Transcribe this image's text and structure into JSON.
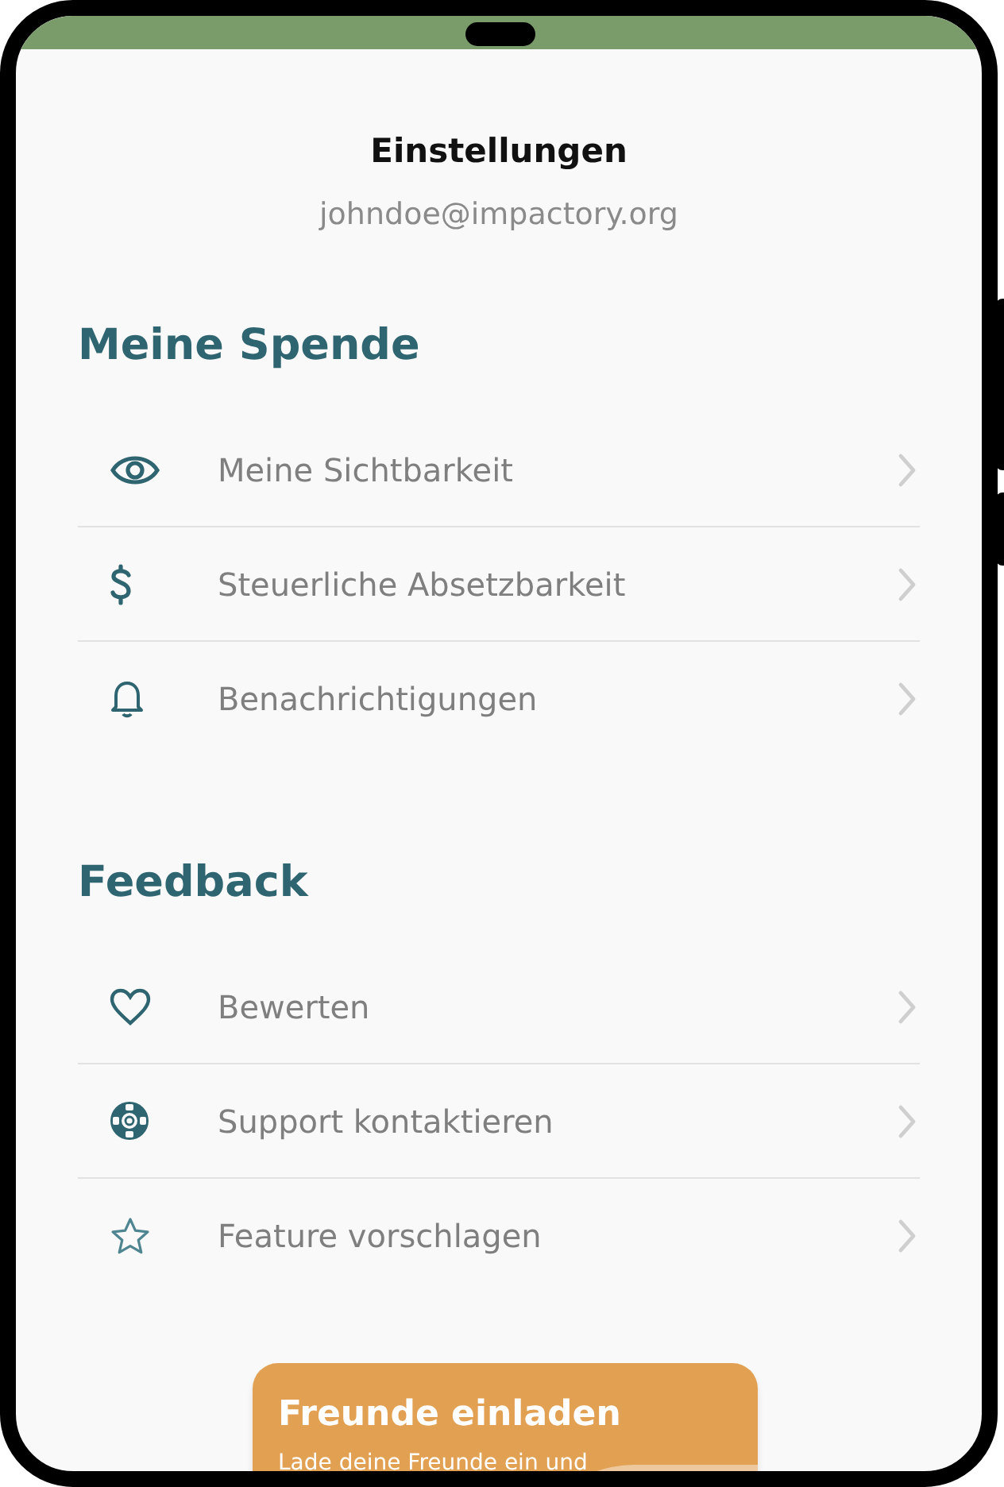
{
  "header": {
    "title": "Einstellungen",
    "email": "johndoe@impactory.org"
  },
  "sections": [
    {
      "title": "Meine Spende",
      "items": [
        {
          "label": "Meine Sichtbarkeit"
        },
        {
          "label": "Steuerliche Absetzbarkeit"
        },
        {
          "label": "Benachrichtigungen"
        }
      ]
    },
    {
      "title": "Feedback",
      "items": [
        {
          "label": "Bewerten"
        },
        {
          "label": "Support kontaktieren"
        },
        {
          "label": "Feature vorschlagen"
        }
      ]
    }
  ],
  "invite_card": {
    "title": "Freunde einladen",
    "text": "Lade deine Freunde ein und"
  }
}
